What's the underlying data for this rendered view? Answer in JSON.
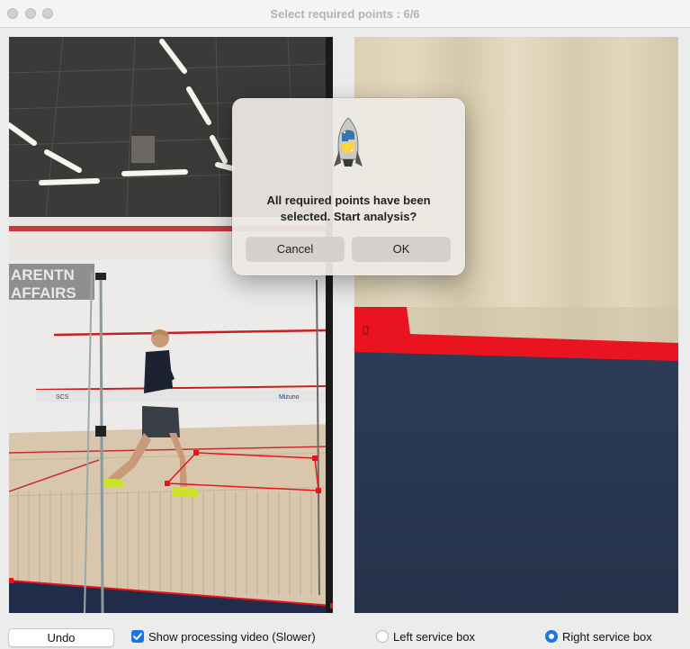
{
  "window": {
    "title": "Select required points : 6/6"
  },
  "left_video": {
    "wall_text_line1": "ARENTN",
    "wall_text_line2": "AFFAIRS",
    "tin_text_1": "SCS",
    "tin_text_2": "Mizuno"
  },
  "dialog": {
    "icon": "python-rocket-icon",
    "message": "All required points have been selected. Start analysis?",
    "cancel_label": "Cancel",
    "ok_label": "OK"
  },
  "controls": {
    "undo_label": "Undo",
    "show_processing_label": "Show processing video (Slower)",
    "show_processing_checked": true,
    "left_service_box_label": "Left service box",
    "left_service_box_selected": false,
    "right_service_box_label": "Right service box",
    "right_service_box_selected": true
  },
  "colors": {
    "accent": "#1a73e8",
    "marker": "#e8141c"
  }
}
